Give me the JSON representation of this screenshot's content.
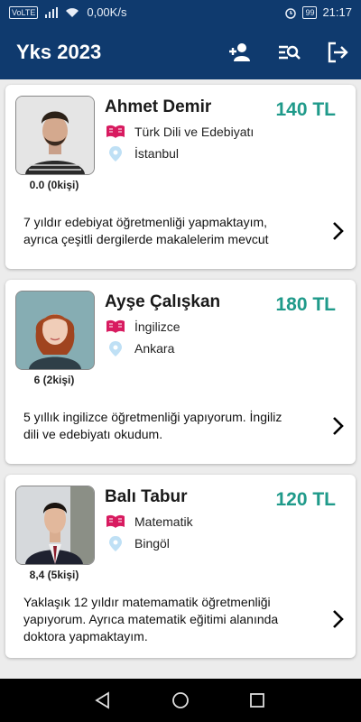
{
  "status_bar": {
    "carrier_badge": "VoLTE",
    "speed": "0,00K/s",
    "battery": "99",
    "time": "21:17"
  },
  "app_bar": {
    "title": "Yks 2023",
    "actions": [
      "add-user-icon",
      "search-list-icon",
      "logout-icon"
    ]
  },
  "accent_color": "#1f9a8a",
  "brand_color": "#0f3a6e",
  "teachers": [
    {
      "name": "Ahmet Demir",
      "price": "140 TL",
      "subject": "Türk Dili ve Edebiyatı",
      "city": "İstanbul",
      "rating": "0.0 (0kişi)",
      "desc_line1": "7 yıldır edebiyat öğretmenliği yapmaktayım,",
      "desc_line2": "ayrıca çeşitli dergilerde makalelerim mevcut",
      "desc_line3": ""
    },
    {
      "name": "Ayşe Çalışkan",
      "price": "180 TL",
      "subject": "İngilizce",
      "city": "Ankara",
      "rating": "6 (2kişi)",
      "desc_line1": "5 yıllık ingilizce öğretmenliği yapıyorum.  İngiliz",
      "desc_line2": "dili ve edebiyatı okudum.",
      "desc_line3": ""
    },
    {
      "name": "Balı Tabur",
      "price": "120 TL",
      "subject": "Matematik",
      "city": "Bingöl",
      "rating": "8,4 (5kişi)",
      "desc_line1": "Yaklaşık 12 yıldır  matemamatik öğretmenliği",
      "desc_line2": "yapıyorum. Ayrıca matematik eğitimi alanında",
      "desc_line3": "doktora yapmaktayım."
    }
  ]
}
